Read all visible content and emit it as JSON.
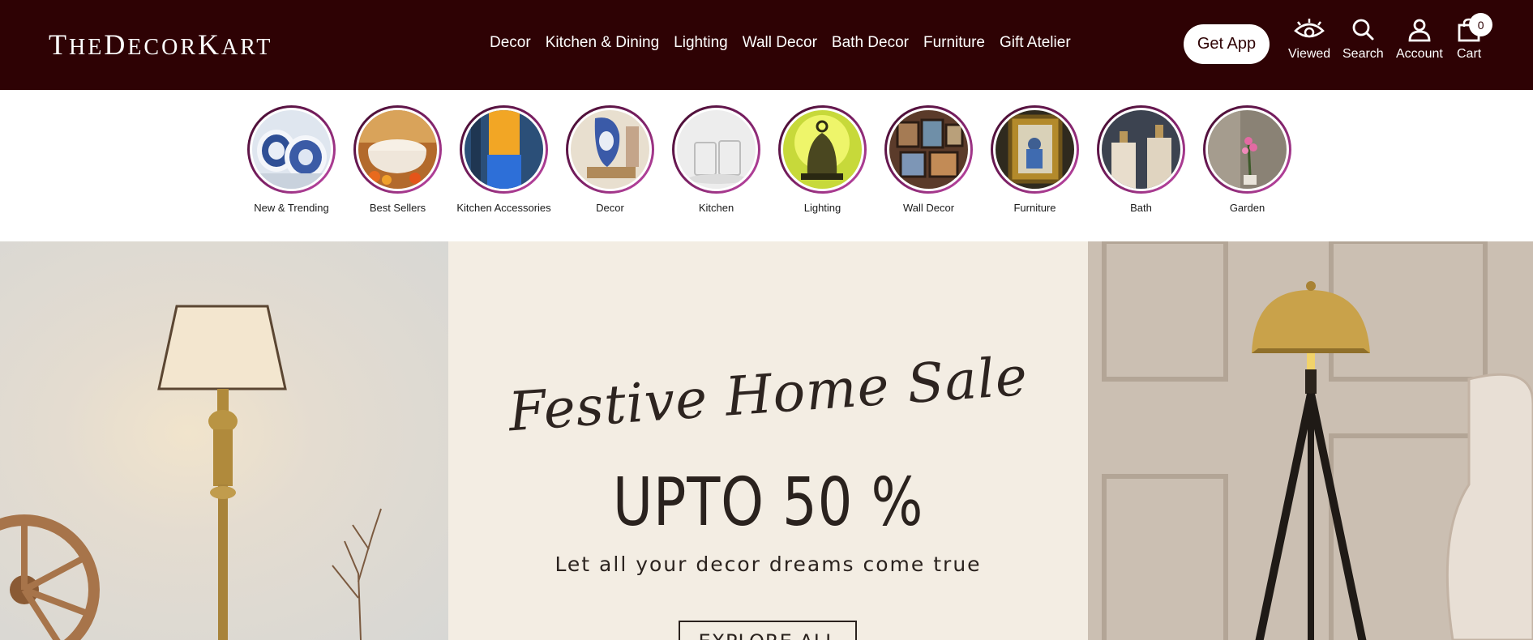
{
  "header": {
    "logo": {
      "t": "T",
      "he": "HE",
      "d": "D",
      "ecor": "ECOR",
      "k": "K",
      "art": "ART"
    },
    "nav": [
      "Decor",
      "Kitchen & Dining",
      "Lighting",
      "Wall Decor",
      "Bath Decor",
      "Furniture",
      "Gift Atelier"
    ],
    "get_app": "Get App",
    "viewed": "Viewed",
    "search": "Search",
    "account": "Account",
    "cart": "Cart",
    "cart_count": "0"
  },
  "categories": [
    {
      "label": "New & Trending"
    },
    {
      "label": "Best Sellers"
    },
    {
      "label": "Kitchen Accessories"
    },
    {
      "label": "Decor"
    },
    {
      "label": "Kitchen"
    },
    {
      "label": "Lighting"
    },
    {
      "label": "Wall Decor"
    },
    {
      "label": "Furniture"
    },
    {
      "label": "Bath"
    },
    {
      "label": "Garden"
    }
  ],
  "hero": {
    "script_title": "Festive Home Sale",
    "headline": "UPTO 50 %",
    "subtitle": "Let all your decor dreams come true",
    "cta": "EXPLORE ALL"
  },
  "colors": {
    "header_bg": "#2e0204",
    "accent_ring": "#7a1f63",
    "hero_bg": "#f3ede3"
  }
}
